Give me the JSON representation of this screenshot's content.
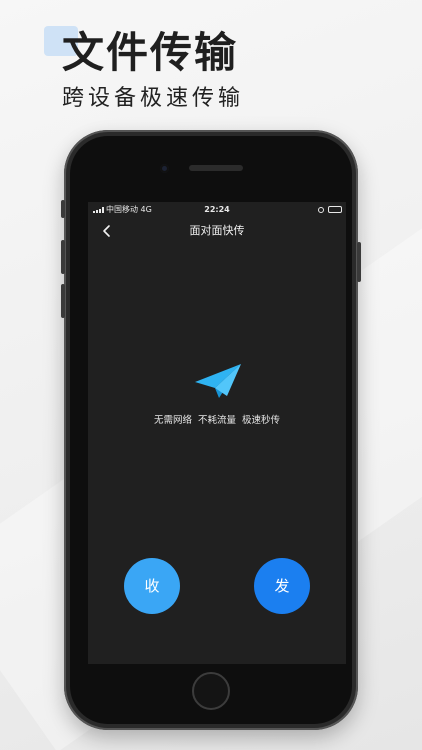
{
  "promo": {
    "headline": "文件传输",
    "subline": "跨设备极速传输"
  },
  "status_bar": {
    "carrier": "中国移动  4G",
    "time": "22:24"
  },
  "nav": {
    "title": "面对面快传",
    "back_icon": "chevron-left-icon"
  },
  "main": {
    "icon": "paper-plane-icon",
    "tagline": "无需网络  不耗流量  极速秒传"
  },
  "actions": {
    "receive_label": "收",
    "send_label": "发"
  },
  "colors": {
    "receive": "#3aa6f5",
    "send": "#1b7ff0",
    "plane": "#2fb3f2",
    "screen_bg": "#202020"
  }
}
